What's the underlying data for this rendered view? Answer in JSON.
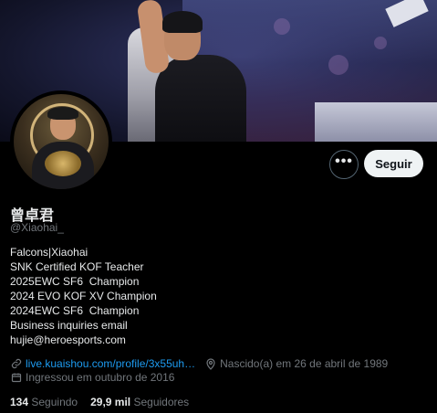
{
  "profile": {
    "display_name": "曾卓君",
    "handle": "@Xiaohai_",
    "bio_lines": [
      "Falcons|Xiaohai",
      "SNK Certified KOF Teacher",
      "2025EWC SF6  Champion",
      "2024 EVO KOF XV Champion",
      "2024EWC SF6  Champion",
      "Business inquiries email",
      "hujie@heroesports.com"
    ],
    "website": "live.kuaishou.com/profile/3x55uh…",
    "birth": "Nascido(a) em 26 de abril de 1989",
    "joined": "Ingressou em outubro de 2016",
    "following_count": "134",
    "following_label": "Seguindo",
    "followers_count": "29,9 mil",
    "followers_label": "Seguidores"
  },
  "actions": {
    "more_label": "•••",
    "follow_label": "Seguir"
  },
  "icons": {
    "link": "link-icon",
    "location": "location-pin-icon",
    "calendar": "calendar-icon"
  },
  "colors": {
    "background": "#000000",
    "accent_link": "#1d9bf0",
    "muted_text": "#71767b",
    "follow_button_bg": "#eff3f4"
  }
}
